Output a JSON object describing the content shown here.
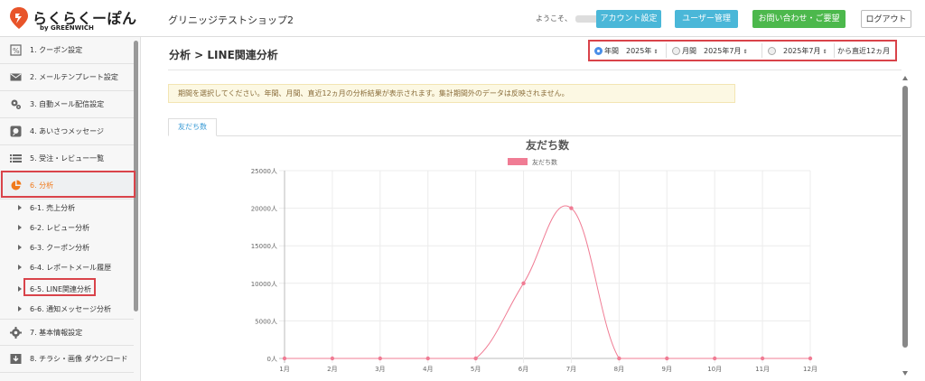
{
  "header": {
    "logo_text": "らくらくーぽん",
    "logo_sub": "by GREENWICH",
    "shop_name": "グリニッジテストショップ2",
    "welcome": "ようこそ、",
    "account_button": "アカウント設定",
    "users_button": "ユーザー管理",
    "contact_button": "お問い合わせ・ご要望",
    "logout_button": "ログアウト"
  },
  "sidebar": {
    "items": [
      {
        "label": "1. クーポン設定",
        "icon": "coupon-icon"
      },
      {
        "label": "2. メールテンプレート設定",
        "icon": "envelope-icon"
      },
      {
        "label": "3. 自動メール配信設定",
        "icon": "gears-icon"
      },
      {
        "label": "4. あいさつメッセージ",
        "icon": "chat-icon"
      },
      {
        "label": "5. 受注・レビュー一覧",
        "icon": "list-icon"
      },
      {
        "label": "6. 分析",
        "icon": "pie-chart-icon",
        "active": true
      },
      {
        "label": "7. 基本情報設定",
        "icon": "gear-icon"
      },
      {
        "label": "8. チラシ・画像 ダウンロード",
        "icon": "download-icon"
      }
    ],
    "subitems": [
      {
        "label": "6-1. 売上分析"
      },
      {
        "label": "6-2. レビュー分析"
      },
      {
        "label": "6-3. クーポン分析"
      },
      {
        "label": "6-4. レポートメール履歴"
      },
      {
        "label": "6-5. LINE関連分析",
        "selected": true
      },
      {
        "label": "6-6. 通知メッセージ分析"
      }
    ]
  },
  "main": {
    "page_title": "分析 > LINE関連分析",
    "period": {
      "year_label": "年間",
      "year_value": "2025年",
      "month_label": "月間",
      "month_value": "2025年7月",
      "recent_value": "2025年7月",
      "recent_suffix": "から直近12ヵ月",
      "selected": "year"
    },
    "notice": "期間を選択してください。年間、月間、直近12ヵ月の分析結果が表示されます。集計期間外のデータは反映されません。",
    "tab_label": "友だち数"
  },
  "colors": {
    "accent_blue": "#4ab7d8",
    "accent_green": "#4cb84c",
    "active_orange": "#f07a1c",
    "highlight_red": "#d9434a",
    "series_pink": "#f07c94"
  },
  "chart_data": {
    "type": "line",
    "title": "友だち数",
    "legend": [
      "友だち数"
    ],
    "legend_position": "top-center",
    "grid": true,
    "categories": [
      "1月",
      "2月",
      "3月",
      "4月",
      "5月",
      "6月",
      "7月",
      "8月",
      "9月",
      "10月",
      "11月",
      "12月"
    ],
    "series": [
      {
        "name": "友だち数",
        "values": [
          0,
          0,
          0,
          0,
          0,
          10000,
          20000,
          0,
          0,
          0,
          0,
          0
        ]
      }
    ],
    "y_ticks": [
      "0人",
      "5000人",
      "10000人",
      "15000人",
      "20000人",
      "25000人"
    ],
    "ylim": [
      0,
      25000
    ]
  }
}
